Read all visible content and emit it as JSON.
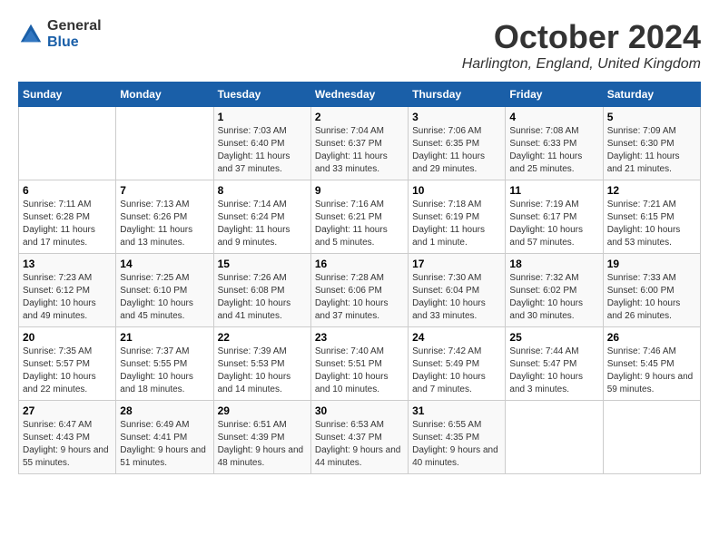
{
  "logo": {
    "line1": "General",
    "line2": "Blue"
  },
  "title": "October 2024",
  "location": "Harlington, England, United Kingdom",
  "days_of_week": [
    "Sunday",
    "Monday",
    "Tuesday",
    "Wednesday",
    "Thursday",
    "Friday",
    "Saturday"
  ],
  "weeks": [
    [
      {
        "day": "",
        "info": ""
      },
      {
        "day": "",
        "info": ""
      },
      {
        "day": "1",
        "info": "Sunrise: 7:03 AM\nSunset: 6:40 PM\nDaylight: 11 hours and 37 minutes."
      },
      {
        "day": "2",
        "info": "Sunrise: 7:04 AM\nSunset: 6:37 PM\nDaylight: 11 hours and 33 minutes."
      },
      {
        "day": "3",
        "info": "Sunrise: 7:06 AM\nSunset: 6:35 PM\nDaylight: 11 hours and 29 minutes."
      },
      {
        "day": "4",
        "info": "Sunrise: 7:08 AM\nSunset: 6:33 PM\nDaylight: 11 hours and 25 minutes."
      },
      {
        "day": "5",
        "info": "Sunrise: 7:09 AM\nSunset: 6:30 PM\nDaylight: 11 hours and 21 minutes."
      }
    ],
    [
      {
        "day": "6",
        "info": "Sunrise: 7:11 AM\nSunset: 6:28 PM\nDaylight: 11 hours and 17 minutes."
      },
      {
        "day": "7",
        "info": "Sunrise: 7:13 AM\nSunset: 6:26 PM\nDaylight: 11 hours and 13 minutes."
      },
      {
        "day": "8",
        "info": "Sunrise: 7:14 AM\nSunset: 6:24 PM\nDaylight: 11 hours and 9 minutes."
      },
      {
        "day": "9",
        "info": "Sunrise: 7:16 AM\nSunset: 6:21 PM\nDaylight: 11 hours and 5 minutes."
      },
      {
        "day": "10",
        "info": "Sunrise: 7:18 AM\nSunset: 6:19 PM\nDaylight: 11 hours and 1 minute."
      },
      {
        "day": "11",
        "info": "Sunrise: 7:19 AM\nSunset: 6:17 PM\nDaylight: 10 hours and 57 minutes."
      },
      {
        "day": "12",
        "info": "Sunrise: 7:21 AM\nSunset: 6:15 PM\nDaylight: 10 hours and 53 minutes."
      }
    ],
    [
      {
        "day": "13",
        "info": "Sunrise: 7:23 AM\nSunset: 6:12 PM\nDaylight: 10 hours and 49 minutes."
      },
      {
        "day": "14",
        "info": "Sunrise: 7:25 AM\nSunset: 6:10 PM\nDaylight: 10 hours and 45 minutes."
      },
      {
        "day": "15",
        "info": "Sunrise: 7:26 AM\nSunset: 6:08 PM\nDaylight: 10 hours and 41 minutes."
      },
      {
        "day": "16",
        "info": "Sunrise: 7:28 AM\nSunset: 6:06 PM\nDaylight: 10 hours and 37 minutes."
      },
      {
        "day": "17",
        "info": "Sunrise: 7:30 AM\nSunset: 6:04 PM\nDaylight: 10 hours and 33 minutes."
      },
      {
        "day": "18",
        "info": "Sunrise: 7:32 AM\nSunset: 6:02 PM\nDaylight: 10 hours and 30 minutes."
      },
      {
        "day": "19",
        "info": "Sunrise: 7:33 AM\nSunset: 6:00 PM\nDaylight: 10 hours and 26 minutes."
      }
    ],
    [
      {
        "day": "20",
        "info": "Sunrise: 7:35 AM\nSunset: 5:57 PM\nDaylight: 10 hours and 22 minutes."
      },
      {
        "day": "21",
        "info": "Sunrise: 7:37 AM\nSunset: 5:55 PM\nDaylight: 10 hours and 18 minutes."
      },
      {
        "day": "22",
        "info": "Sunrise: 7:39 AM\nSunset: 5:53 PM\nDaylight: 10 hours and 14 minutes."
      },
      {
        "day": "23",
        "info": "Sunrise: 7:40 AM\nSunset: 5:51 PM\nDaylight: 10 hours and 10 minutes."
      },
      {
        "day": "24",
        "info": "Sunrise: 7:42 AM\nSunset: 5:49 PM\nDaylight: 10 hours and 7 minutes."
      },
      {
        "day": "25",
        "info": "Sunrise: 7:44 AM\nSunset: 5:47 PM\nDaylight: 10 hours and 3 minutes."
      },
      {
        "day": "26",
        "info": "Sunrise: 7:46 AM\nSunset: 5:45 PM\nDaylight: 9 hours and 59 minutes."
      }
    ],
    [
      {
        "day": "27",
        "info": "Sunrise: 6:47 AM\nSunset: 4:43 PM\nDaylight: 9 hours and 55 minutes."
      },
      {
        "day": "28",
        "info": "Sunrise: 6:49 AM\nSunset: 4:41 PM\nDaylight: 9 hours and 51 minutes."
      },
      {
        "day": "29",
        "info": "Sunrise: 6:51 AM\nSunset: 4:39 PM\nDaylight: 9 hours and 48 minutes."
      },
      {
        "day": "30",
        "info": "Sunrise: 6:53 AM\nSunset: 4:37 PM\nDaylight: 9 hours and 44 minutes."
      },
      {
        "day": "31",
        "info": "Sunrise: 6:55 AM\nSunset: 4:35 PM\nDaylight: 9 hours and 40 minutes."
      },
      {
        "day": "",
        "info": ""
      },
      {
        "day": "",
        "info": ""
      }
    ]
  ]
}
